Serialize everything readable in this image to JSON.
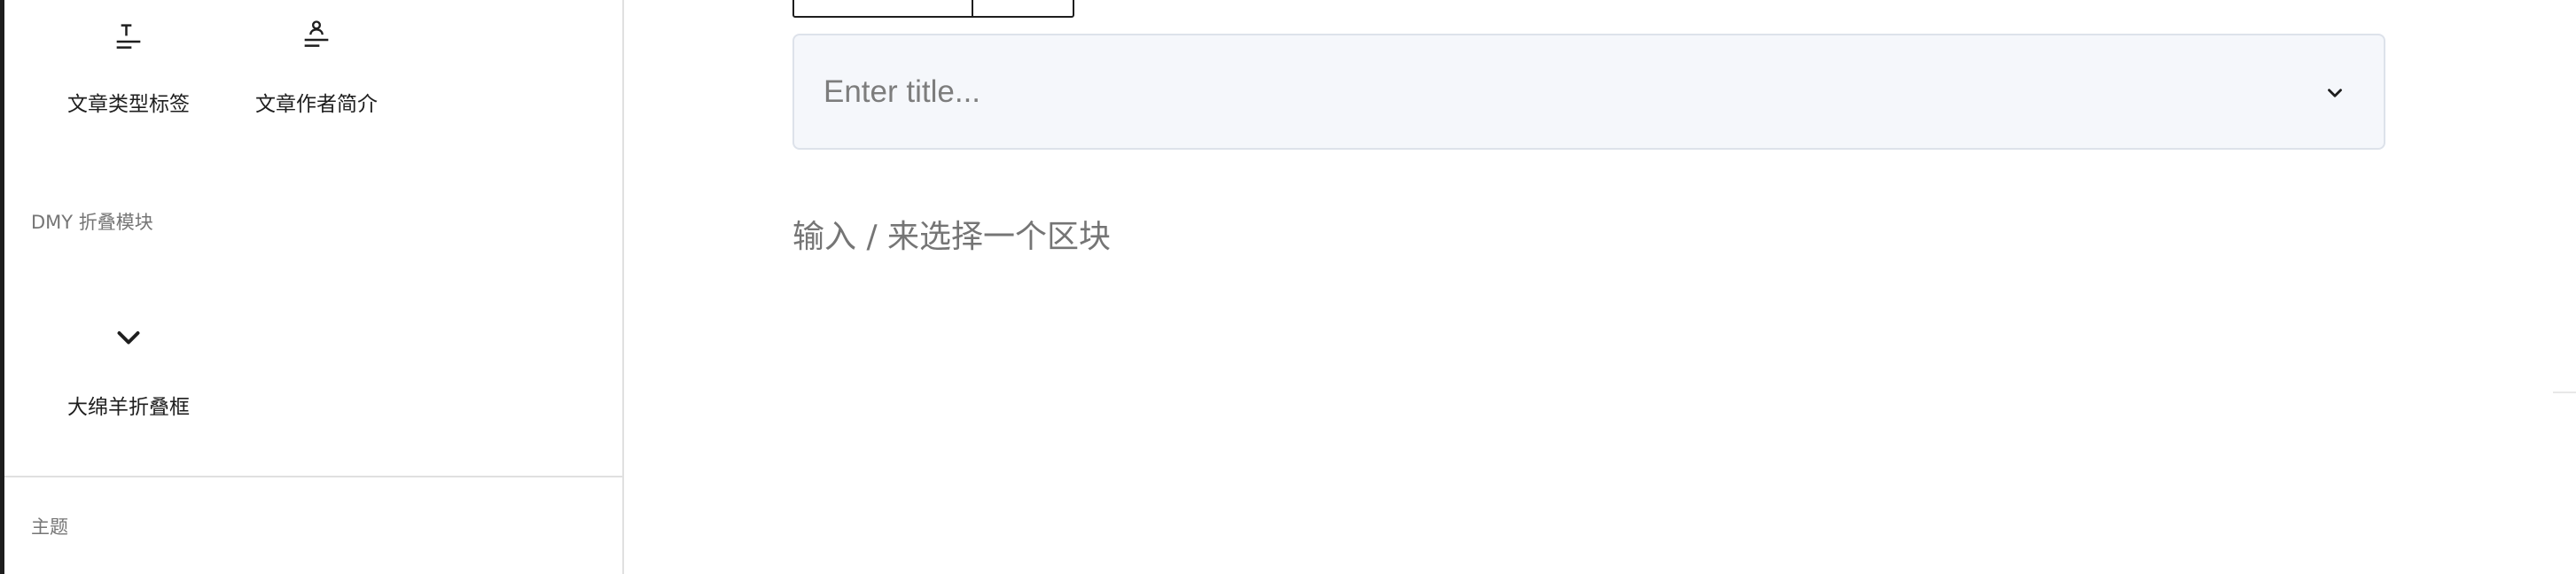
{
  "inserter": {
    "blocks_top": [
      {
        "label": "文章类型标签",
        "icon": "post-type-tag-icon"
      },
      {
        "label": "文章作者简介",
        "icon": "post-author-bio-icon"
      }
    ],
    "categories": [
      {
        "name": "DMY 折叠模块",
        "blocks": [
          {
            "label": "大绵羊折叠框",
            "icon": "chevron-down-icon"
          }
        ]
      },
      {
        "name": "主题",
        "blocks": []
      }
    ]
  },
  "editor": {
    "accordion": {
      "title_placeholder": "Enter title...",
      "toggle_icon": "chevron-down-icon"
    },
    "appender_placeholder": "输入 / 来选择一个区块"
  },
  "colors": {
    "accordion_bg": "#f5f7fb",
    "accordion_border": "#dde2ea",
    "muted_text": "#757575",
    "text": "#1e1e1e"
  }
}
